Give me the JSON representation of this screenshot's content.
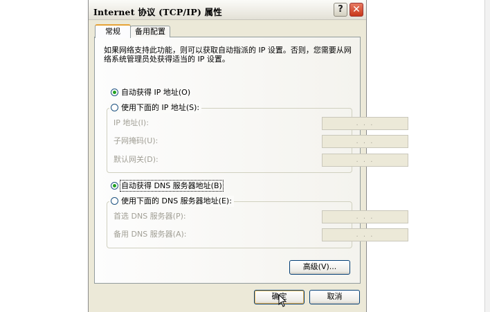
{
  "dialog": {
    "title": "Internet 协议 (TCP/IP) 属性",
    "help_label": "?",
    "close_label": "✕"
  },
  "tabs": [
    {
      "label": "常规",
      "selected": true
    },
    {
      "label": "备用配置",
      "selected": false
    }
  ],
  "description": "如果网络支持此功能，则可以获取自动指派的 IP 设置。否则，您需要从网络系统管理员处获得适当的 IP 设置。",
  "ip_section": {
    "auto_option": "自动获得 IP 地址(O)",
    "manual_option": "使用下面的 IP 地址(S):",
    "selected": "auto",
    "fields": [
      {
        "label": "IP 地址(I):",
        "value": ". . ."
      },
      {
        "label": "子网掩码(U):",
        "value": ". . ."
      },
      {
        "label": "默认网关(D):",
        "value": ". . ."
      }
    ]
  },
  "dns_section": {
    "auto_option": "自动获得 DNS 服务器地址(B)",
    "manual_option": "使用下面的 DNS 服务器地址(E):",
    "selected": "auto",
    "fields": [
      {
        "label": "首选 DNS 服务器(P):",
        "value": ". . ."
      },
      {
        "label": "备用 DNS 服务器(A):",
        "value": ". . ."
      }
    ]
  },
  "buttons": {
    "advanced": "高级(V)...",
    "ok": "确定",
    "cancel": "取消"
  },
  "icons": [
    "help-icon",
    "close-icon",
    "mouse-cursor-icon"
  ]
}
